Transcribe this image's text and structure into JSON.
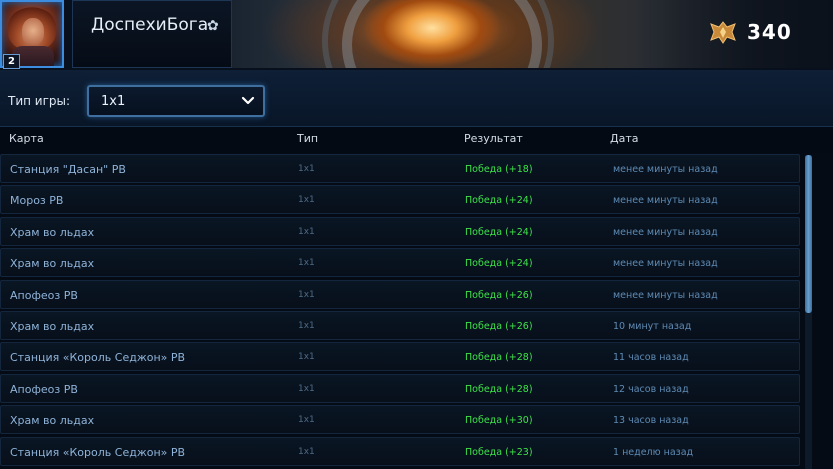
{
  "header": {
    "player_name": "ДоспехиБога",
    "level": "2",
    "rating": "340",
    "avatar_icon": "portrait-icon",
    "rating_icon": "rank-wings-icon",
    "settings_icon": "gear-icon"
  },
  "filter": {
    "label": "Тип игры:",
    "selected": "1x1",
    "icon": "chevron-down-icon"
  },
  "table": {
    "columns": [
      "Карта",
      "Тип",
      "Результат",
      "Дата"
    ],
    "rows": [
      {
        "map": "Станция \"Дасан\" РВ",
        "type": "1x1",
        "result": "Победа (+18)",
        "date": "менее минуты назад"
      },
      {
        "map": "Мороз РВ",
        "type": "1x1",
        "result": "Победа (+24)",
        "date": "менее минуты назад"
      },
      {
        "map": "Храм во льдах",
        "type": "1x1",
        "result": "Победа (+24)",
        "date": "менее минуты назад"
      },
      {
        "map": "Храм во льдах",
        "type": "1x1",
        "result": "Победа (+24)",
        "date": "менее минуты назад"
      },
      {
        "map": "Апофеоз РВ",
        "type": "1x1",
        "result": "Победа (+26)",
        "date": "менее минуты назад"
      },
      {
        "map": "Храм во льдах",
        "type": "1x1",
        "result": "Победа (+26)",
        "date": "10 минут назад"
      },
      {
        "map": "Станция «Король Седжон» РВ",
        "type": "1x1",
        "result": "Победа (+28)",
        "date": "11 часов назад"
      },
      {
        "map": "Апофеоз РВ",
        "type": "1x1",
        "result": "Победа (+28)",
        "date": "12 часов назад"
      },
      {
        "map": "Храм во льдах",
        "type": "1x1",
        "result": "Победа (+30)",
        "date": "13 часов назад"
      },
      {
        "map": "Станция «Король Седжон» РВ",
        "type": "1x1",
        "result": "Победа (+23)",
        "date": "1 неделю назад"
      }
    ]
  },
  "colors": {
    "win": "#3ee34a",
    "map_text": "#8fb3d8",
    "date_text": "#5e8ab3",
    "accent": "#3f6f9f"
  }
}
